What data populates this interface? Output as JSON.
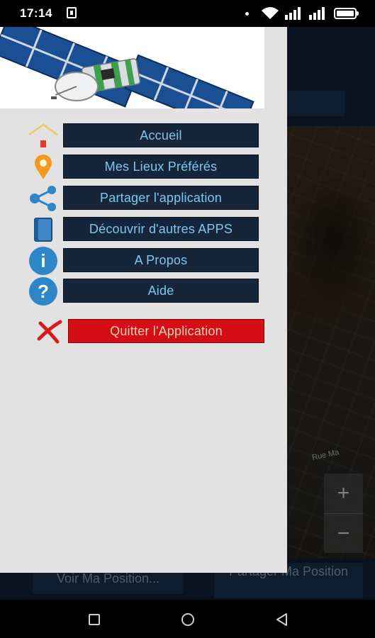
{
  "status_bar": {
    "time": "17:14"
  },
  "background_screen": {
    "street_label": "Rue Ma",
    "zoom_in": "+",
    "zoom_out": "−",
    "left_button": "Voir Ma Position...",
    "right_button": "Partager Ma Position"
  },
  "drawer": {
    "items": [
      {
        "label": "Accueil",
        "icon": "home-icon"
      },
      {
        "label": "Mes Lieux Préférés",
        "icon": "location-pin-icon"
      },
      {
        "label": "Partager l'application",
        "icon": "share-icon"
      },
      {
        "label": "Découvrir d'autres APPS",
        "icon": "book-icon"
      },
      {
        "label": "A Propos",
        "icon": "info-icon",
        "glyph": "i"
      },
      {
        "label": "Aide",
        "icon": "help-icon",
        "glyph": "?"
      }
    ],
    "quit": {
      "label": "Quitter l'Application",
      "icon": "red-x-icon"
    }
  },
  "colors": {
    "drawer_bg": "#e2e2e2",
    "menu_button_bg": "#16263a",
    "menu_button_text": "#7fc6ee",
    "quit_button_bg": "#d50d15",
    "icon_blue": "#2d86c8"
  }
}
